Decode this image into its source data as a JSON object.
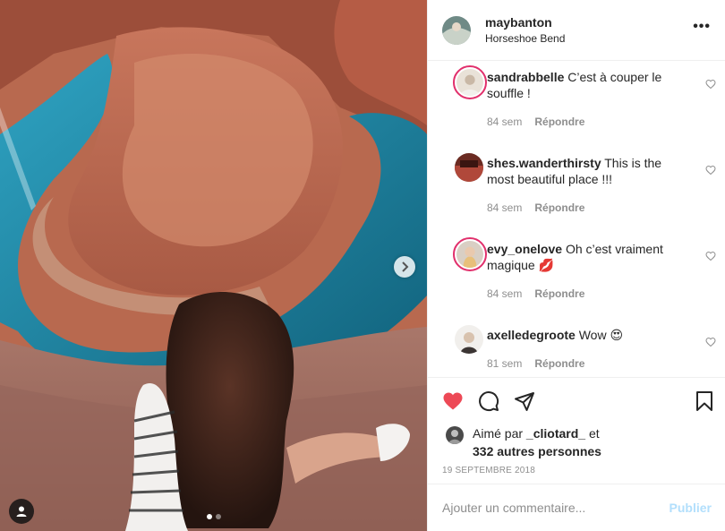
{
  "post": {
    "username": "maybanton",
    "location": "Horseshoe Bend",
    "more_icon": "ellipsis-icon",
    "carousel": {
      "slides": 2,
      "active": 0
    }
  },
  "comments": [
    {
      "user": "sandrabbelle",
      "text": "C’est à couper le souffle !",
      "age": "84 sem",
      "reply": "Répondre",
      "ring": true
    },
    {
      "user": "shes.wanderthirsty",
      "text": "This is the most beautiful place !!!",
      "age": "84 sem",
      "reply": "Répondre",
      "ring": false
    },
    {
      "user": "evy_onelove",
      "text": "Oh c’est vraiment magique 💋",
      "age": "84 sem",
      "reply": "Répondre",
      "ring": true
    },
    {
      "user": "axelledegroote",
      "text": "Wow 😍",
      "age": "81 sem",
      "reply": "Répondre",
      "ring": false
    }
  ],
  "actions": {
    "liked": true,
    "like_color": "#ed4956",
    "icons": [
      "heart-icon",
      "comment-icon",
      "share-icon",
      "bookmark-icon"
    ]
  },
  "likes": {
    "prefix": "Aimé par",
    "user": "_cliotard_",
    "joiner": "et",
    "others": "332 autres personnes"
  },
  "date": "19 SEPTEMBRE 2018",
  "add_comment": {
    "placeholder": "Ajouter un commentaire...",
    "publish": "Publier"
  }
}
